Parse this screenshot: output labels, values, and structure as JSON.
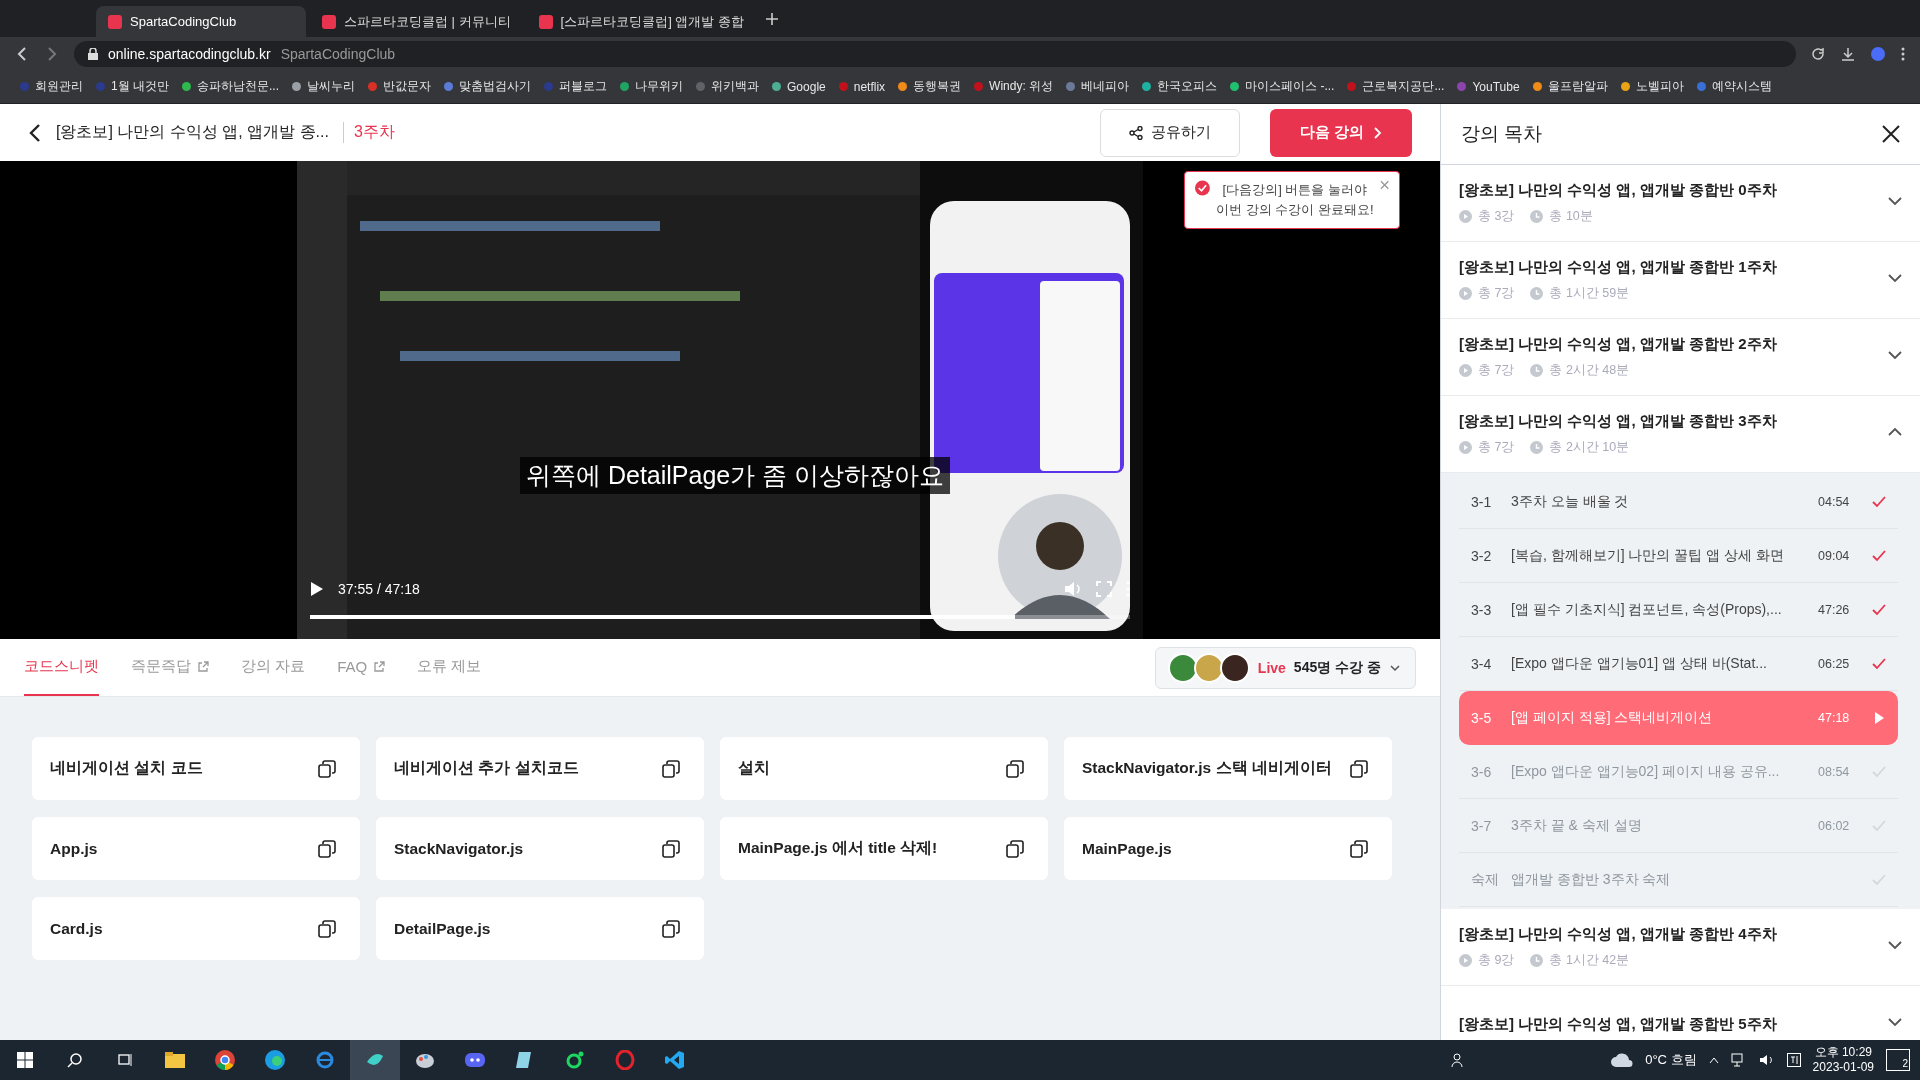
{
  "browser": {
    "tabs": [
      {
        "title": "SpartaCodingClub",
        "selected": true
      },
      {
        "title": "스파르타코딩클럽 | 커뮤니티",
        "selected": false
      },
      {
        "title": "[스파르타코딩클럽] 앱개발 종합",
        "selected": false
      }
    ],
    "address": {
      "host": "online.spartacodingclub.kr",
      "page_title": "SpartaCodingClub"
    },
    "bookmarks": [
      {
        "label": "회원관리",
        "color": "#2b3a8c"
      },
      {
        "label": "1월 내것만",
        "color": "#2b3a8c"
      },
      {
        "label": "송파하남천문...",
        "color": "#2eb84d"
      },
      {
        "label": "날씨누리",
        "color": "#9aa0a6"
      },
      {
        "label": "반값문자",
        "color": "#d93025"
      },
      {
        "label": "맞춤법검사기",
        "color": "#5a7bd8"
      },
      {
        "label": "퍼블로그",
        "color": "#2b3a8c"
      },
      {
        "label": "나무위키",
        "color": "#1fa463"
      },
      {
        "label": "위키백과",
        "color": "#5f6368"
      },
      {
        "label": "Google",
        "color": "#4caf93"
      },
      {
        "label": "netflix",
        "color": "#c0121c"
      },
      {
        "label": "동행복권",
        "color": "#f08a18"
      },
      {
        "label": "Windy: 위성",
        "color": "#c0121c"
      },
      {
        "label": "베네피아",
        "color": "#6b7a99"
      },
      {
        "label": "한국오피스",
        "color": "#20b0a0"
      },
      {
        "label": "마이스페이스 -...",
        "color": "#20c070"
      },
      {
        "label": "근로복지공단...",
        "color": "#c0121c"
      },
      {
        "label": "YouTube",
        "color": "#8e44ad"
      },
      {
        "label": "울프람알파",
        "color": "#f08a18"
      },
      {
        "label": "노벨피아",
        "color": "#e8a317"
      },
      {
        "label": "예약시스템",
        "color": "#3b6fd8"
      }
    ]
  },
  "header": {
    "title": "[왕초보] 나만의 수익성 앱, 앱개발 종...",
    "week": "3주차",
    "share": "공유하기",
    "next": "다음 강의"
  },
  "tooltip": {
    "text": "[다음강의] 버튼을 눌러야 이번 강의 수강이 완료돼요!"
  },
  "video": {
    "subtitle": "위쪽에 DetailPage가 좀 이상하잖아요",
    "time": "37:55 / 47:18",
    "progress": {
      "level": 0.86
    }
  },
  "lesson_tabs": [
    {
      "label": "코드스니펫",
      "selected": true,
      "external": false
    },
    {
      "label": "즉문즉답",
      "selected": false,
      "external": true
    },
    {
      "label": "강의 자료",
      "selected": false,
      "external": false
    },
    {
      "label": "FAQ",
      "selected": false,
      "external": true
    },
    {
      "label": "오류 제보",
      "selected": false,
      "external": false
    }
  ],
  "live": {
    "badge": "Live",
    "viewers": "545명 수강 중"
  },
  "snippets": [
    "네비게이션 설치 코드",
    "네비게이션 추가 설치코드",
    "설치",
    "StackNavigator.js 스택 네비게이터",
    "App.js",
    "StackNavigator.js",
    "MainPage.js 에서 title 삭제!",
    "MainPage.js",
    "Card.js",
    "DetailPage.js"
  ],
  "toc": {
    "title": "강의 목차",
    "sections": [
      {
        "title": "[왕초보] 나만의 수익성 앱, 앱개발 종합반 0주차",
        "lessons_count": "총 3강",
        "duration": "총 10분",
        "expanded": false
      },
      {
        "title": "[왕초보] 나만의 수익성 앱, 앱개발 종합반 1주차",
        "lessons_count": "총 7강",
        "duration": "총 1시간 59분",
        "expanded": false
      },
      {
        "title": "[왕초보] 나만의 수익성 앱, 앱개발 종합반 2주차",
        "lessons_count": "총 7강",
        "duration": "총 2시간 48분",
        "expanded": false
      },
      {
        "title": "[왕초보] 나만의 수익성 앱, 앱개발 종합반 3주차",
        "lessons_count": "총 7강",
        "duration": "총 2시간 10분",
        "expanded": true,
        "lessons": [
          {
            "number": "3-1",
            "title": "3주차 오늘 배울 것",
            "duration": "04:54",
            "completed": true,
            "selected": false
          },
          {
            "number": "3-2",
            "title": "[복습, 함께해보기] 나만의 꿀팁 앱 상세 화면",
            "duration": "09:04",
            "completed": true,
            "selected": false
          },
          {
            "number": "3-3",
            "title": "[앱 필수 기초지식] 컴포넌트, 속성(Props),...",
            "duration": "47:26",
            "completed": true,
            "selected": false
          },
          {
            "number": "3-4",
            "title": "[Expo 앱다운 앱기능01] 앱 상태 바(Stat...",
            "duration": "06:25",
            "completed": true,
            "selected": false
          },
          {
            "number": "3-5",
            "title": "[앱 페이지 적용] 스택네비게이션",
            "duration": "47:18",
            "completed": false,
            "selected": true
          },
          {
            "number": "3-6",
            "title": "[Expo 앱다운 앱기능02] 페이지 내용 공유...",
            "duration": "08:54",
            "completed": false,
            "selected": false
          },
          {
            "number": "3-7",
            "title": "3주차 끝 & 숙제 설명",
            "duration": "06:02",
            "completed": false,
            "selected": false
          },
          {
            "number": "숙제",
            "title": "앱개발 종합반 3주차 숙제",
            "completed": false,
            "selected": false
          }
        ]
      },
      {
        "title": "[왕초보] 나만의 수익성 앱, 앱개발 종합반 4주차",
        "lessons_count": "총 9강",
        "duration": "총 1시간 42분",
        "expanded": false
      },
      {
        "title": "[왕초보] 나만의 수익성 앱, 앱개발 종합반 5주차",
        "expanded": false
      }
    ]
  },
  "taskbar": {
    "weather": "0°C 흐림",
    "time": "오후 10:29",
    "date": "2023-01-09",
    "notifications": "2"
  }
}
